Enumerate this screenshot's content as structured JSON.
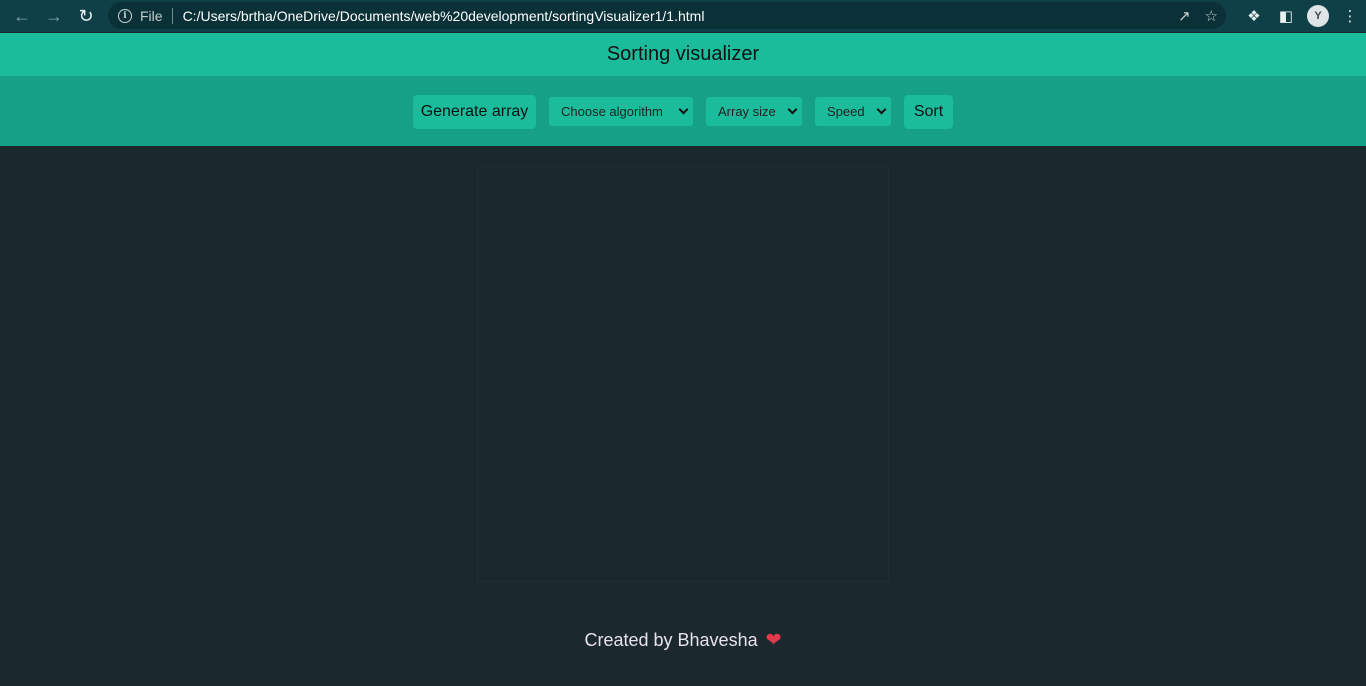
{
  "browser": {
    "scheme": "File",
    "url": "C:/Users/brtha/OneDrive/Documents/web%20development/sortingVisualizer1/1.html",
    "avatar_initial": "Y"
  },
  "page": {
    "title": "Sorting visualizer",
    "buttons": {
      "generate": "Generate array",
      "sort": "Sort"
    },
    "selects": {
      "algorithm": "Choose algorithm",
      "array_size": "Array size",
      "speed": "Speed"
    },
    "footer": "Created by Bhavesha",
    "colors": {
      "header": "#1abc9c",
      "controls": "#16a085",
      "background": "#1b292e"
    }
  }
}
